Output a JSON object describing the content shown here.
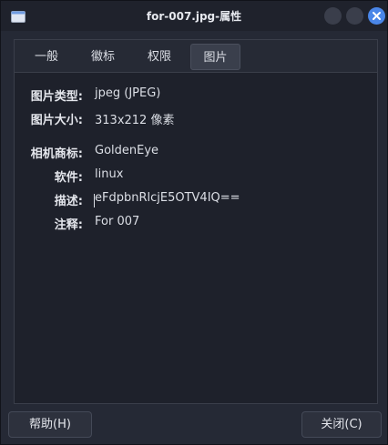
{
  "window": {
    "title": "for-007.jpg-属性",
    "app_icon": "folder-icon",
    "controls": [
      "minimize-icon",
      "maximize-icon",
      "close-icon"
    ]
  },
  "tabs": [
    {
      "label": "一般",
      "active": false
    },
    {
      "label": "徽标",
      "active": false
    },
    {
      "label": "权限",
      "active": false
    },
    {
      "label": "图片",
      "active": true
    }
  ],
  "image_info": {
    "type_label": "图片类型:",
    "type_value": "jpeg (JPEG)",
    "size_label": "图片大小:",
    "size_value": "313x212 像素"
  },
  "metadata": {
    "camera_label": "相机商标:",
    "camera_value": "GoldenEye",
    "software_label": "软件:",
    "software_value": "linux",
    "description_label": "描述:",
    "description_value": "eFdpbnRlcjE5OTV4IQ==",
    "comment_label": "注释:",
    "comment_value": "For 007"
  },
  "buttons": {
    "help": "帮助(H)",
    "close": "关闭(C)"
  },
  "colors": {
    "accent": "#4a86e8",
    "background": "#252935",
    "panel": "#1e212b"
  }
}
